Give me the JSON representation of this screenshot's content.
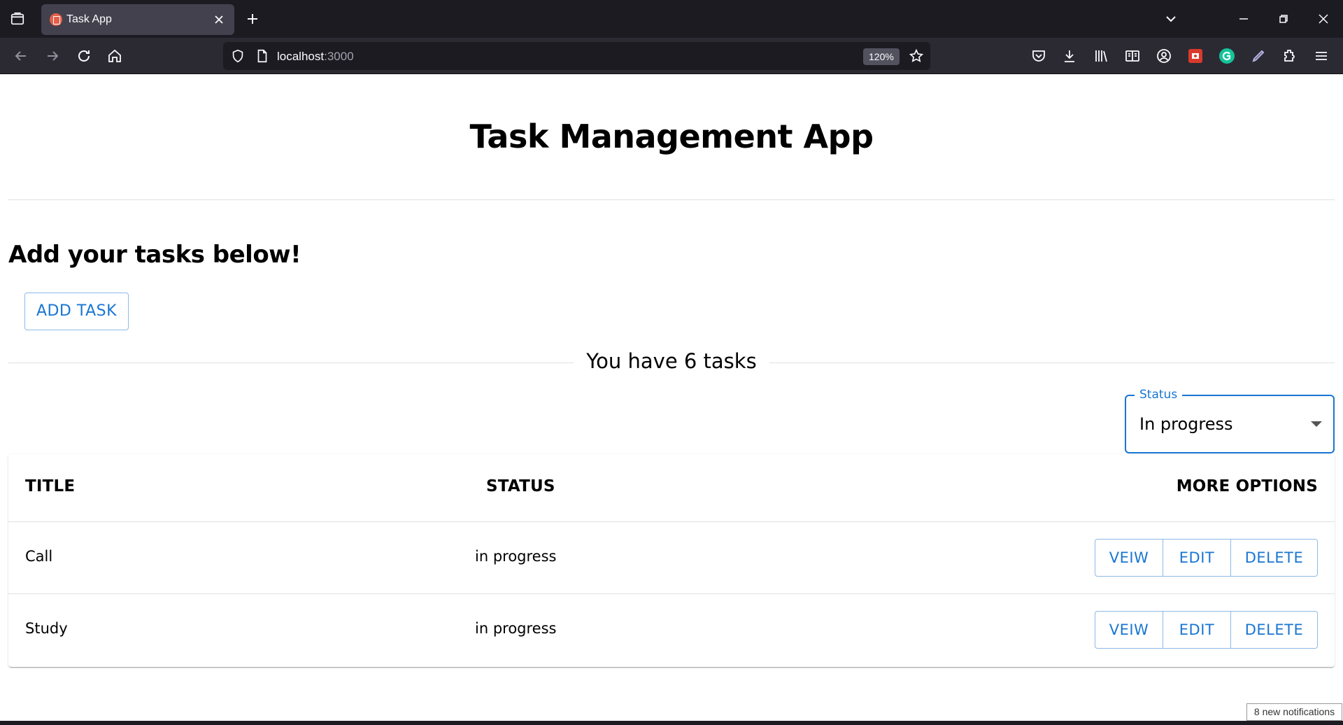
{
  "browser": {
    "tab_title": "Task App",
    "url_host": "localhost",
    "url_port": ":3000",
    "zoom": "120%",
    "icons": [
      "tab-list-icon",
      "close-icon",
      "plus-icon",
      "chevron-down-icon",
      "minimize-icon",
      "restore-icon",
      "window-close-icon",
      "back-icon",
      "forward-icon",
      "reload-icon",
      "home-icon",
      "shield-icon",
      "page-icon",
      "star-icon",
      "pocket-icon",
      "download-icon",
      "library-icon",
      "reader-icon",
      "account-icon",
      "extension-red-icon",
      "grammarly-icon",
      "pen-icon",
      "extensions-icon",
      "menu-icon"
    ]
  },
  "app": {
    "title": "Task Management App",
    "subheading": "Add your tasks below!",
    "add_button": "ADD TASK",
    "task_count_text": "You have 6 tasks",
    "filter": {
      "label": "Status",
      "value": "In progress"
    },
    "table": {
      "headers": [
        "TITLE",
        "STATUS",
        "MORE OPTIONS"
      ],
      "rows": [
        {
          "title": "Call",
          "status": "in progress"
        },
        {
          "title": "Study",
          "status": "in progress"
        }
      ],
      "actions": [
        "VEIW",
        "EDIT",
        "DELETE"
      ]
    }
  },
  "notification": "8 new notifications",
  "colors": {
    "primary": "#1976d2",
    "chrome_dark": "#1c1b22",
    "chrome_toolbar": "#2b2a33"
  }
}
